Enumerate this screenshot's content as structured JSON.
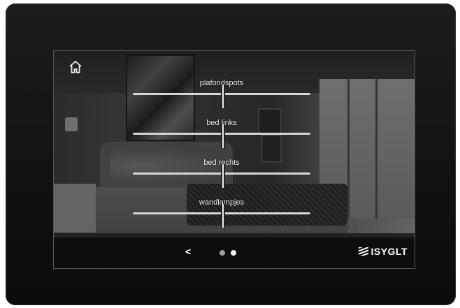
{
  "screen": {
    "controls": [
      {
        "label": "plafondspots",
        "level": 50
      },
      {
        "label": "bed links",
        "level": 50
      },
      {
        "label": "bed rechts",
        "level": 50
      },
      {
        "label": "wandlampjes",
        "level": 50
      }
    ],
    "nav": {
      "back_label": "<",
      "pages": 2,
      "current_page": 2
    },
    "brand": "ISYGLT",
    "icons": {
      "home": "home-icon",
      "brand_mark": "isyglt-logo-icon"
    }
  }
}
